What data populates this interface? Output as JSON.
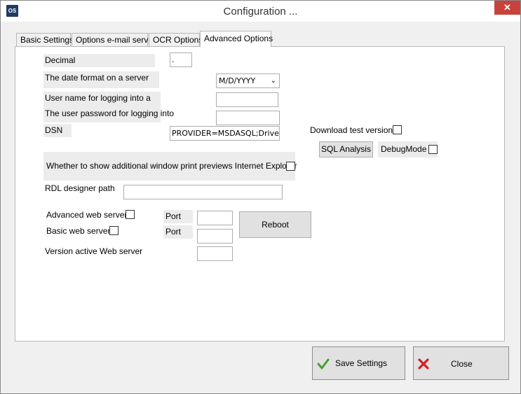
{
  "window": {
    "title": "Configuration ...",
    "app_icon": "OS",
    "close_glyph": "✕"
  },
  "tabs": [
    {
      "label": "Basic Settings",
      "active": false
    },
    {
      "label": "Options e-mail server",
      "active": false
    },
    {
      "label": "OCR Options",
      "active": false
    },
    {
      "label": "Advanced Options",
      "active": true
    }
  ],
  "form": {
    "decimal_label": "Decimal",
    "decimal_value": ".",
    "date_format_label": "The date format on a server",
    "date_format_value": "M/D/YYYY",
    "username_label": "User name for logging into a",
    "username_value": "",
    "password_label": "The user password for logging into",
    "password_value": "",
    "dsn_label": "DSN",
    "dsn_value": "PROVIDER=MSDASQL;Driver=",
    "download_test_label": "Download test versions",
    "download_test_checked": false,
    "sql_analysis_button": "SQL Analysis",
    "debug_mode_label": "DebugMode",
    "debug_mode_checked": false,
    "print_preview_label": "Whether to show additional window print previews Internet Explorer",
    "print_preview_checked": false,
    "rdl_label": "RDL designer path",
    "rdl_value": "",
    "advanced_web_label": "Advanced web server",
    "advanced_web_checked": false,
    "basic_web_label": "Basic web server",
    "basic_web_checked": false,
    "port_label_1": "Port",
    "port_value_1": "",
    "port_label_2": "Port",
    "port_value_2": "",
    "version_active_label": "Version active Web server",
    "version_active_value": "",
    "reboot_button": "Reboot"
  },
  "footer": {
    "save_label": "Save Settings",
    "close_label": "Close",
    "save_icon_color": "#4aa02c",
    "close_icon_color": "#d42020"
  }
}
